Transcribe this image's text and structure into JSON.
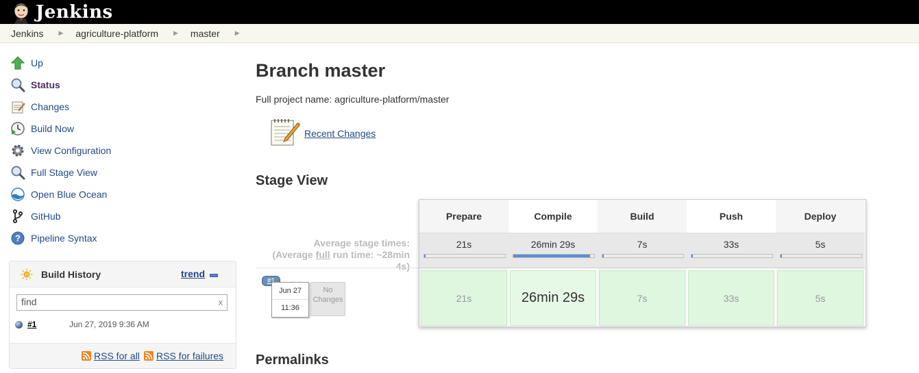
{
  "header": {
    "logo_text": "Jenkins",
    "logo_icon": "jenkins-butler-icon"
  },
  "breadcrumb": [
    "Jenkins",
    "agriculture-platform",
    "master"
  ],
  "tasks": [
    {
      "label": "Up",
      "icon": "arrow-up-icon"
    },
    {
      "label": "Status",
      "icon": "magnifier-icon"
    },
    {
      "label": "Changes",
      "icon": "notepad-icon"
    },
    {
      "label": "Build Now",
      "icon": "clock-play-icon"
    },
    {
      "label": "View Configuration",
      "icon": "gear-icon"
    },
    {
      "label": "Full Stage View",
      "icon": "magnifier-icon"
    },
    {
      "label": "Open Blue Ocean",
      "icon": "blue-ocean-icon"
    },
    {
      "label": "GitHub",
      "icon": "git-branch-icon"
    },
    {
      "label": "Pipeline Syntax",
      "icon": "help-icon"
    }
  ],
  "build_history": {
    "title": "Build History",
    "trend": "trend",
    "search_value": "find",
    "clear": "x",
    "builds": [
      {
        "number": "#1",
        "date": "Jun 27, 2019 9:36 AM",
        "status_color": "#3e5e93"
      }
    ],
    "rss_all": "RSS for all",
    "rss_failures": "RSS for failures"
  },
  "main": {
    "title": "Branch master",
    "full_name": "Full project name: agriculture-platform/master",
    "recent_changes": "Recent Changes",
    "stage_view_title": "Stage View",
    "permalinks_title": "Permalinks"
  },
  "stage_view": {
    "avg_label_1": "Average stage times:",
    "avg_label_2a": "(Average ",
    "avg_label_2b": "full",
    "avg_label_2c": " run time: ~28min",
    "avg_label_3": "4s)",
    "run": {
      "badge": "#1",
      "month_day": "Jun 27",
      "time": "11:36",
      "no_changes": "No Changes"
    },
    "stages": [
      {
        "name": "Prepare",
        "avg": "21s",
        "run": "21s",
        "progress": 0.01
      },
      {
        "name": "Compile",
        "avg": "26min 29s",
        "run": "26min 29s",
        "progress": 0.95
      },
      {
        "name": "Build",
        "avg": "7s",
        "run": "7s",
        "progress": 0.005
      },
      {
        "name": "Push",
        "avg": "33s",
        "run": "33s",
        "progress": 0.02
      },
      {
        "name": "Deploy",
        "avg": "5s",
        "run": "5s",
        "progress": 0.004
      }
    ]
  }
}
